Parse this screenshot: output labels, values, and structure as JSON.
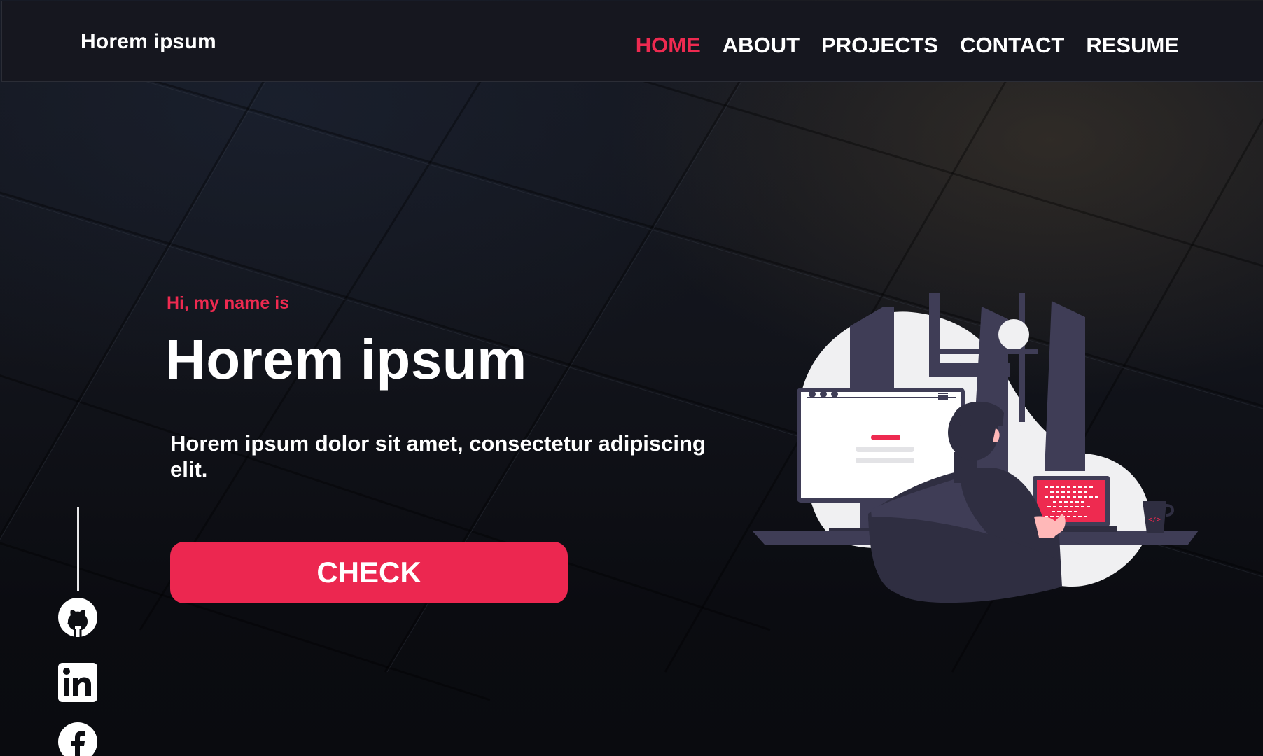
{
  "header": {
    "brand": "Horem ipsum",
    "nav": [
      {
        "label": "HOME",
        "active": true
      },
      {
        "label": "ABOUT",
        "active": false
      },
      {
        "label": "PROJECTS",
        "active": false
      },
      {
        "label": "CONTACT",
        "active": false
      },
      {
        "label": "RESUME",
        "active": false
      }
    ]
  },
  "hero": {
    "greeting": "Hi, my name is",
    "title": "Horem ipsum",
    "description": "Horem ipsum dolor sit amet, consectetur adipiscing elit.",
    "cta_label": "CHECK"
  },
  "social": {
    "icons": [
      "github-icon",
      "linkedin-icon",
      "facebook-icon"
    ]
  },
  "colors": {
    "accent": "#ee2a50",
    "header_bg": "#16171f",
    "page_bg": "#0d0e13",
    "text": "#ffffff"
  }
}
